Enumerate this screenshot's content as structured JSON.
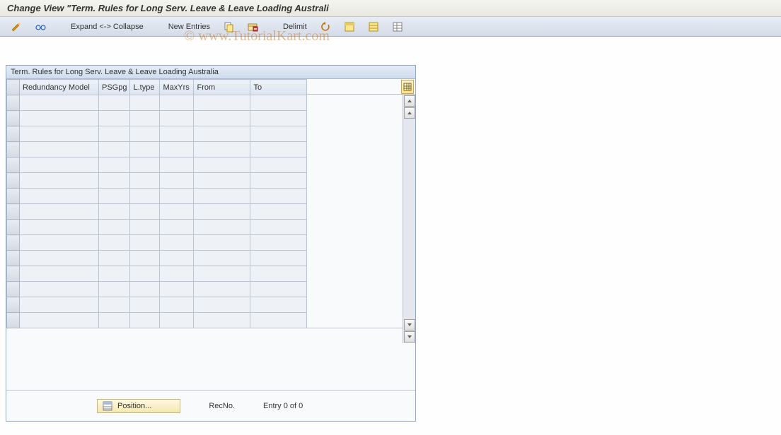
{
  "title": "Change View \"Term. Rules for Long Serv. Leave & Leave Loading Australi",
  "watermark": "© www.TutorialKart.com",
  "toolbar": {
    "expand_collapse": "Expand <-> Collapse",
    "new_entries": "New Entries",
    "delimit": "Delimit"
  },
  "panel": {
    "title": "Term. Rules for Long Serv. Leave & Leave Loading Australia",
    "columns": {
      "redundancy": "Redundancy Model",
      "psgpg": "PSGpg",
      "ltype": "L.type",
      "maxyrs": "MaxYrs",
      "from": "From",
      "to": "To"
    },
    "rows": [
      {
        "redundancy": "",
        "psgpg": "",
        "ltype": "",
        "maxyrs": "",
        "from": "",
        "to": ""
      },
      {
        "redundancy": "",
        "psgpg": "",
        "ltype": "",
        "maxyrs": "",
        "from": "",
        "to": ""
      },
      {
        "redundancy": "",
        "psgpg": "",
        "ltype": "",
        "maxyrs": "",
        "from": "",
        "to": ""
      },
      {
        "redundancy": "",
        "psgpg": "",
        "ltype": "",
        "maxyrs": "",
        "from": "",
        "to": ""
      },
      {
        "redundancy": "",
        "psgpg": "",
        "ltype": "",
        "maxyrs": "",
        "from": "",
        "to": ""
      },
      {
        "redundancy": "",
        "psgpg": "",
        "ltype": "",
        "maxyrs": "",
        "from": "",
        "to": ""
      },
      {
        "redundancy": "",
        "psgpg": "",
        "ltype": "",
        "maxyrs": "",
        "from": "",
        "to": ""
      },
      {
        "redundancy": "",
        "psgpg": "",
        "ltype": "",
        "maxyrs": "",
        "from": "",
        "to": ""
      },
      {
        "redundancy": "",
        "psgpg": "",
        "ltype": "",
        "maxyrs": "",
        "from": "",
        "to": ""
      },
      {
        "redundancy": "",
        "psgpg": "",
        "ltype": "",
        "maxyrs": "",
        "from": "",
        "to": ""
      },
      {
        "redundancy": "",
        "psgpg": "",
        "ltype": "",
        "maxyrs": "",
        "from": "",
        "to": ""
      },
      {
        "redundancy": "",
        "psgpg": "",
        "ltype": "",
        "maxyrs": "",
        "from": "",
        "to": ""
      },
      {
        "redundancy": "",
        "psgpg": "",
        "ltype": "",
        "maxyrs": "",
        "from": "",
        "to": ""
      },
      {
        "redundancy": "",
        "psgpg": "",
        "ltype": "",
        "maxyrs": "",
        "from": "",
        "to": ""
      },
      {
        "redundancy": "",
        "psgpg": "",
        "ltype": "",
        "maxyrs": "",
        "from": "",
        "to": ""
      }
    ]
  },
  "footer": {
    "position": "Position...",
    "recno_label": "RecNo.",
    "recno_value": "",
    "entry": "Entry 0 of 0"
  }
}
